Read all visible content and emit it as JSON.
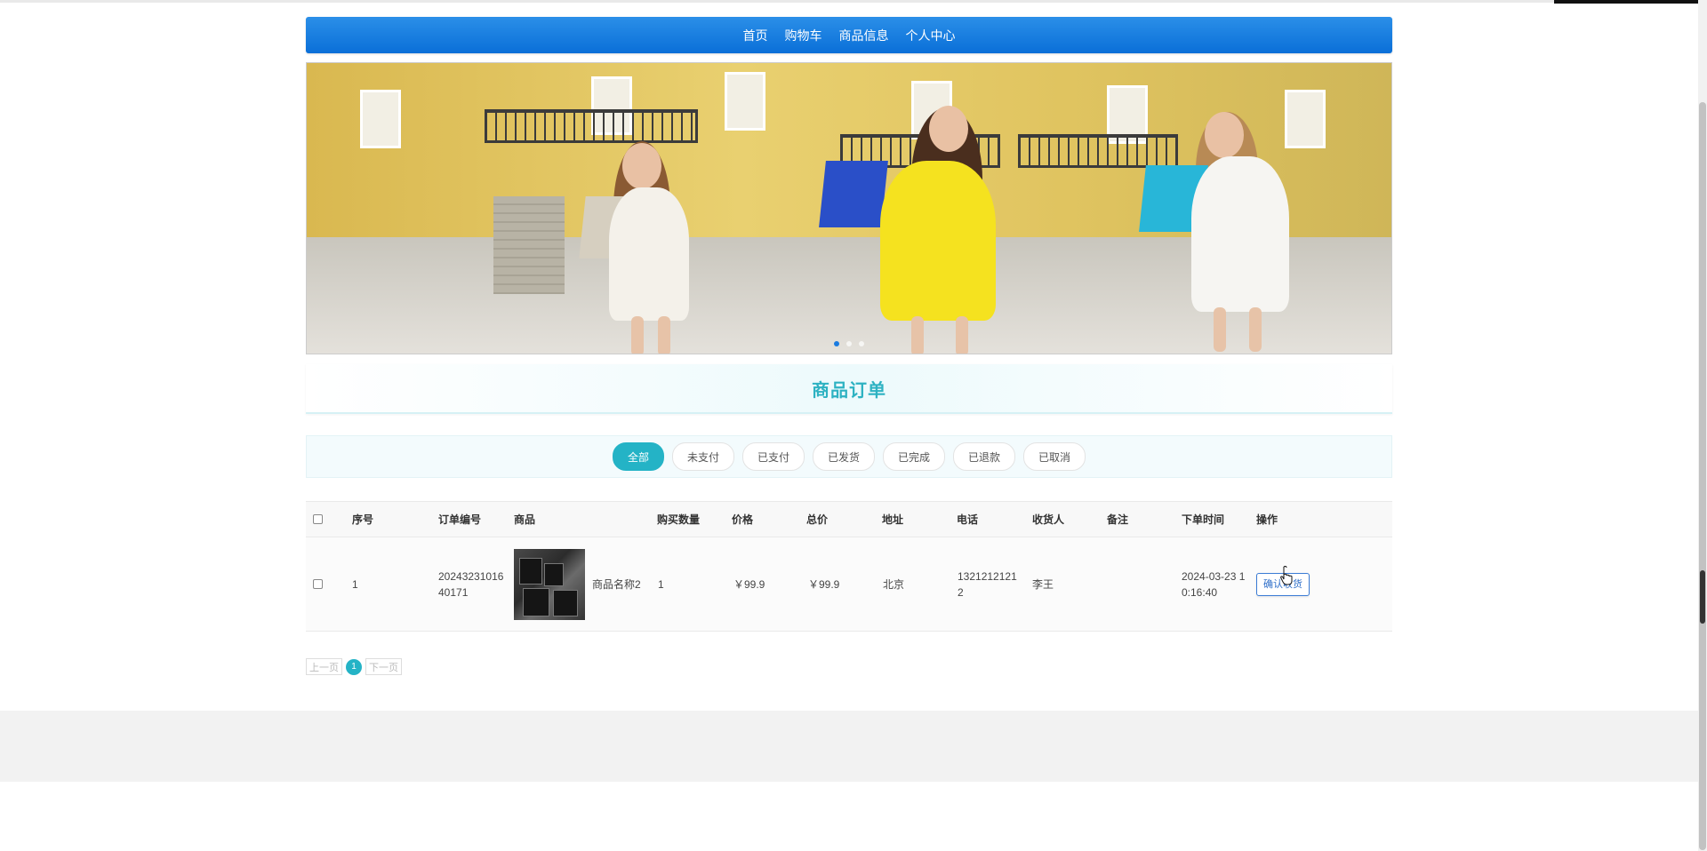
{
  "nav": {
    "items": [
      "首页",
      "购物车",
      "商品信息",
      "个人中心"
    ]
  },
  "banner": {
    "slides": 3,
    "active_slide": 1
  },
  "page_title": "商品订单",
  "filters": {
    "items": [
      "全部",
      "未支付",
      "已支付",
      "已发货",
      "已完成",
      "已退款",
      "已取消"
    ],
    "active": "全部"
  },
  "table": {
    "headers": [
      "序号",
      "订单编号",
      "商品",
      "购买数量",
      "价格",
      "总价",
      "地址",
      "电话",
      "收货人",
      "备注",
      "下单时间",
      "操作"
    ],
    "rows": [
      {
        "index": "1",
        "order_no": "2024323101640171",
        "product_name": "商品名称2",
        "quantity": "1",
        "price": "￥99.9",
        "total": "￥99.9",
        "address": "北京",
        "phone": "13212121212",
        "receiver": "李王",
        "note": "",
        "order_time": "2024-03-23 10:16:40",
        "action": "确认收货"
      }
    ]
  },
  "pager": {
    "prev": "上一页",
    "current": "1",
    "next": "下一页"
  },
  "colors": {
    "nav": "#0a6fd8",
    "accent": "#24b3c6",
    "title": "#2eb2c2"
  }
}
